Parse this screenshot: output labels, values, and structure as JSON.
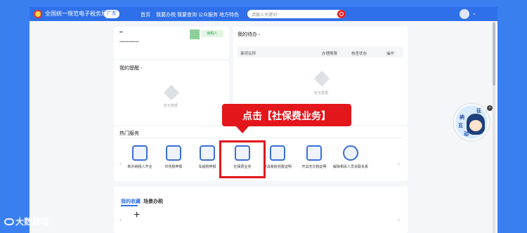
{
  "header": {
    "site_title": "全国统一规范电子税务局",
    "region": "广东",
    "nav": [
      "首页",
      "我要办税",
      "我要查询",
      "公众服务",
      "地方特色"
    ],
    "search_placeholder": "请输入关键词"
  },
  "account": {
    "name": "••",
    "masked_id": "••••••••••••••••",
    "role_badge": "纳税人"
  },
  "todo": {
    "title": "我的待办",
    "columns": [
      "事项名称",
      "办理期限",
      "核查状态",
      "操作"
    ],
    "empty": "暂无数据"
  },
  "reminder": {
    "title": "我的提醒",
    "empty": "暂无数据"
  },
  "hot_services": {
    "title": "热门服务",
    "items": [
      "新办纳税人开业",
      "印花税申报",
      "车船税申报",
      "社保费业务",
      "开具税收完税证明",
      "开具无欠税证明",
      "解除相关人员关联关系"
    ]
  },
  "callout": "点击【社保费业务】",
  "favorites": {
    "tabs": [
      "我的收藏",
      "场景办税"
    ]
  },
  "mascot_text": [
    "征",
    "纳",
    "互",
    "动"
  ],
  "watermark": "大数跨境",
  "colors": {
    "brand_blue": "#2f70ea",
    "highlight_red": "#e3161b",
    "search_red": "#e0242b"
  }
}
